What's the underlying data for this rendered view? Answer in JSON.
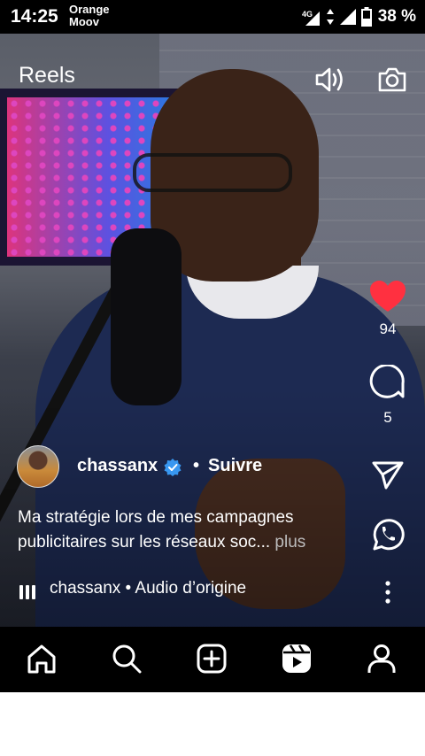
{
  "status_bar": {
    "time": "14:25",
    "carrier_line1": "Orange",
    "carrier_line2": "Moov",
    "network": "4G",
    "battery": "38 %",
    "icons": [
      "network-4g-icon",
      "data-arrows-icon",
      "signal-icon",
      "battery-icon"
    ]
  },
  "header": {
    "title": "Reels",
    "sound_icon": "speaker-icon",
    "camera_icon": "camera-icon"
  },
  "actions": {
    "like_count": "94",
    "comment_count": "5",
    "like_color": "#ff3040",
    "icons": [
      "heart-icon",
      "comment-icon",
      "send-icon",
      "whatsapp-icon",
      "more-vertical-icon"
    ]
  },
  "post": {
    "username": "chassanx",
    "follow_label": "Suivre",
    "caption_line1": "Ma stratégie lors de mes campagnes",
    "caption_line2": "publicitaires sur les réseaux soc...",
    "more_label": " plus",
    "audio_label": "chassanx • Audio d’origine",
    "verified_color": "#3897f0"
  },
  "bottom_nav": {
    "icons": [
      "home-icon",
      "search-icon",
      "create-icon",
      "reels-icon",
      "profile-icon"
    ]
  }
}
